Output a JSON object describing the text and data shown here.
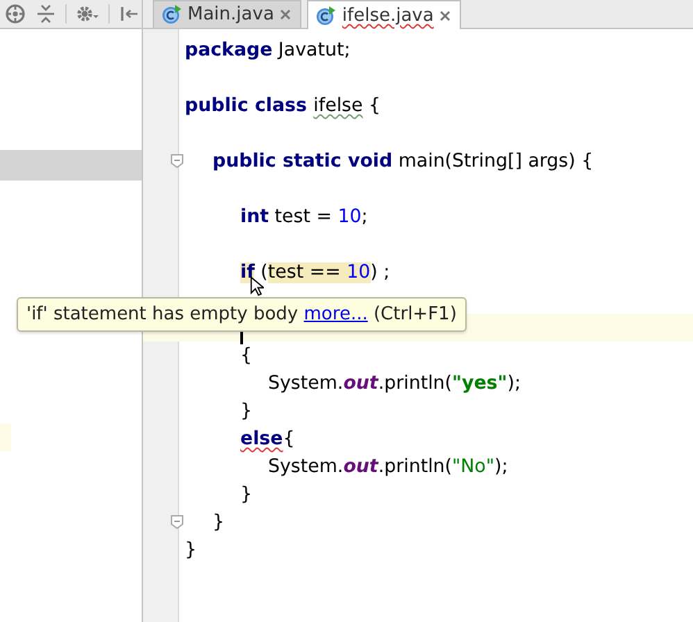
{
  "toolbar": {
    "icons": [
      {
        "kind": "locate"
      },
      {
        "kind": "collapse"
      },
      {
        "kind": "settings"
      },
      {
        "kind": "hide"
      }
    ]
  },
  "tabs": [
    {
      "label": "Main.java",
      "selected": false,
      "error": false
    },
    {
      "label": "ifelse.java",
      "selected": true,
      "error": true
    }
  ],
  "project_panel": {
    "selected_row": true
  },
  "code": [
    {
      "kind": "code",
      "tokens": [
        {
          "text": "package",
          "kind": "keyword"
        },
        {
          "text": " Javatut;",
          "kind": "plain"
        }
      ]
    },
    {
      "kind": "blank"
    },
    {
      "kind": "code",
      "tokens": [
        {
          "text": "public class ",
          "kind": "keyword"
        },
        {
          "text": "ifelse",
          "kind": "plain",
          "typo": true
        },
        {
          "text": " {",
          "kind": "plain"
        }
      ],
      "children": [
        {
          "kind": "blank"
        },
        {
          "kind": "code",
          "fold_marker": true,
          "tokens": [
            {
              "text": "public static void",
              "kind": "keyword"
            },
            {
              "text": " main(String[] args) {",
              "kind": "plain"
            }
          ],
          "children": [
            {
              "kind": "blank"
            },
            {
              "kind": "code",
              "tokens": [
                {
                  "text": "int",
                  "kind": "keyword"
                },
                {
                  "text": " test = ",
                  "kind": "plain"
                },
                {
                  "text": "10",
                  "kind": "number"
                },
                {
                  "text": ";",
                  "kind": "plain"
                }
              ]
            },
            {
              "kind": "blank"
            },
            {
              "kind": "code",
              "tokens": [
                {
                  "text": "if",
                  "kind": "keyword",
                  "highlight": true
                },
                {
                  "text": " (",
                  "kind": "plain"
                },
                {
                  "text": "test == ",
                  "kind": "plain",
                  "highlight": true
                },
                {
                  "text": "10",
                  "kind": "number",
                  "highlight": true
                },
                {
                  "text": ") ;",
                  "kind": "plain"
                }
              ]
            },
            {
              "kind": "blank"
            },
            {
              "kind": "blank",
              "current": true
            },
            {
              "kind": "code",
              "tokens": [
                {
                  "text": "{",
                  "kind": "plain"
                }
              ],
              "children": [
                {
                  "kind": "code",
                  "tokens": [
                    {
                      "text": "System.",
                      "kind": "plain"
                    },
                    {
                      "text": "out",
                      "kind": "field"
                    },
                    {
                      "text": ".println(",
                      "kind": "plain"
                    },
                    {
                      "text": "\"yes\"",
                      "kind": "string"
                    },
                    {
                      "text": ");",
                      "kind": "plain"
                    }
                  ]
                }
              ]
            },
            {
              "kind": "code",
              "tokens": [
                {
                  "text": "}",
                  "kind": "plain"
                }
              ]
            },
            {
              "kind": "code",
              "tokens": [
                {
                  "text": "else",
                  "kind": "keyword",
                  "error": true
                },
                {
                  "text": "{",
                  "kind": "plain"
                }
              ],
              "children": [
                {
                  "kind": "code",
                  "tokens": [
                    {
                      "text": "System.",
                      "kind": "plain"
                    },
                    {
                      "text": "out",
                      "kind": "field"
                    },
                    {
                      "text": ".println(",
                      "kind": "plain"
                    },
                    {
                      "text": "\"No\"",
                      "kind": "string_plain"
                    },
                    {
                      "text": ");",
                      "kind": "plain"
                    }
                  ]
                }
              ]
            },
            {
              "kind": "code",
              "tokens": [
                {
                  "text": "}",
                  "kind": "plain"
                }
              ]
            }
          ]
        },
        {
          "kind": "code",
          "fold_marker": true,
          "tokens": [
            {
              "text": "}",
              "kind": "plain"
            }
          ]
        }
      ]
    },
    {
      "kind": "code",
      "tokens": [
        {
          "text": "}",
          "kind": "plain"
        }
      ]
    }
  ],
  "tooltip": {
    "text": "'if' statement has empty body",
    "link": "more...",
    "shortcut": "(Ctrl+F1)"
  }
}
